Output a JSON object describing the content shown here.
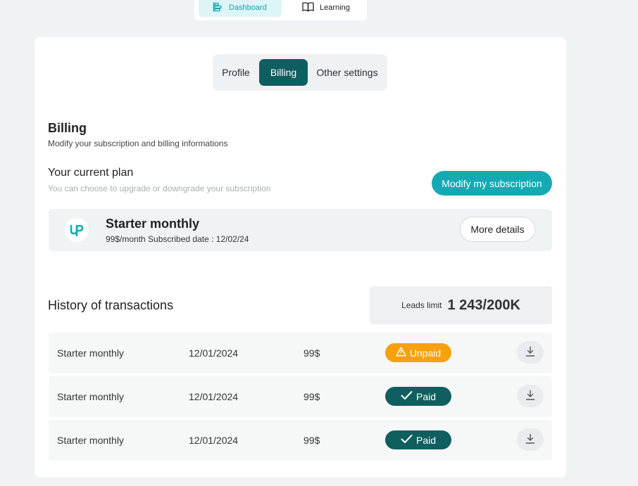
{
  "top_nav": {
    "items": [
      {
        "label": "Dashboard",
        "icon": "dashboard-icon",
        "active": true
      },
      {
        "label": "Learning",
        "icon": "book-icon",
        "active": false
      }
    ]
  },
  "tabs": [
    {
      "label": "Profile",
      "active": false
    },
    {
      "label": "Billing",
      "active": true
    },
    {
      "label": "Other settings",
      "active": false
    }
  ],
  "billing": {
    "title": "Billing",
    "subtitle": "Modify your subscription and billing informations"
  },
  "current_plan": {
    "title": "Your current plan",
    "subtitle": "You can choose to upgrade or downgrade your subscription",
    "modify_button": "Modify my subscription",
    "plan_name": "Starter monthly",
    "plan_meta": "99$/month Subscribed date : 12/02/24",
    "details_button": "More details",
    "logo_icon": "brand-logo-icon"
  },
  "history": {
    "title": "History of transactions",
    "leads_label": "Leads limit",
    "leads_value": "1 243/200K",
    "transactions": [
      {
        "plan": "Starter monthly",
        "date": "12/01/2024",
        "amount": "99$",
        "status": "Unpaid",
        "status_icon": "warning-icon"
      },
      {
        "plan": "Starter monthly",
        "date": "12/01/2024",
        "amount": "99$",
        "status": "Paid",
        "status_icon": "check-icon"
      },
      {
        "plan": "Starter monthly",
        "date": "12/01/2024",
        "amount": "99$",
        "status": "Paid",
        "status_icon": "check-icon"
      }
    ]
  },
  "colors": {
    "primary": "#0f5e60",
    "accent": "#15aab3",
    "unpaid": "#f7a10e",
    "background": "#eff3f4"
  }
}
